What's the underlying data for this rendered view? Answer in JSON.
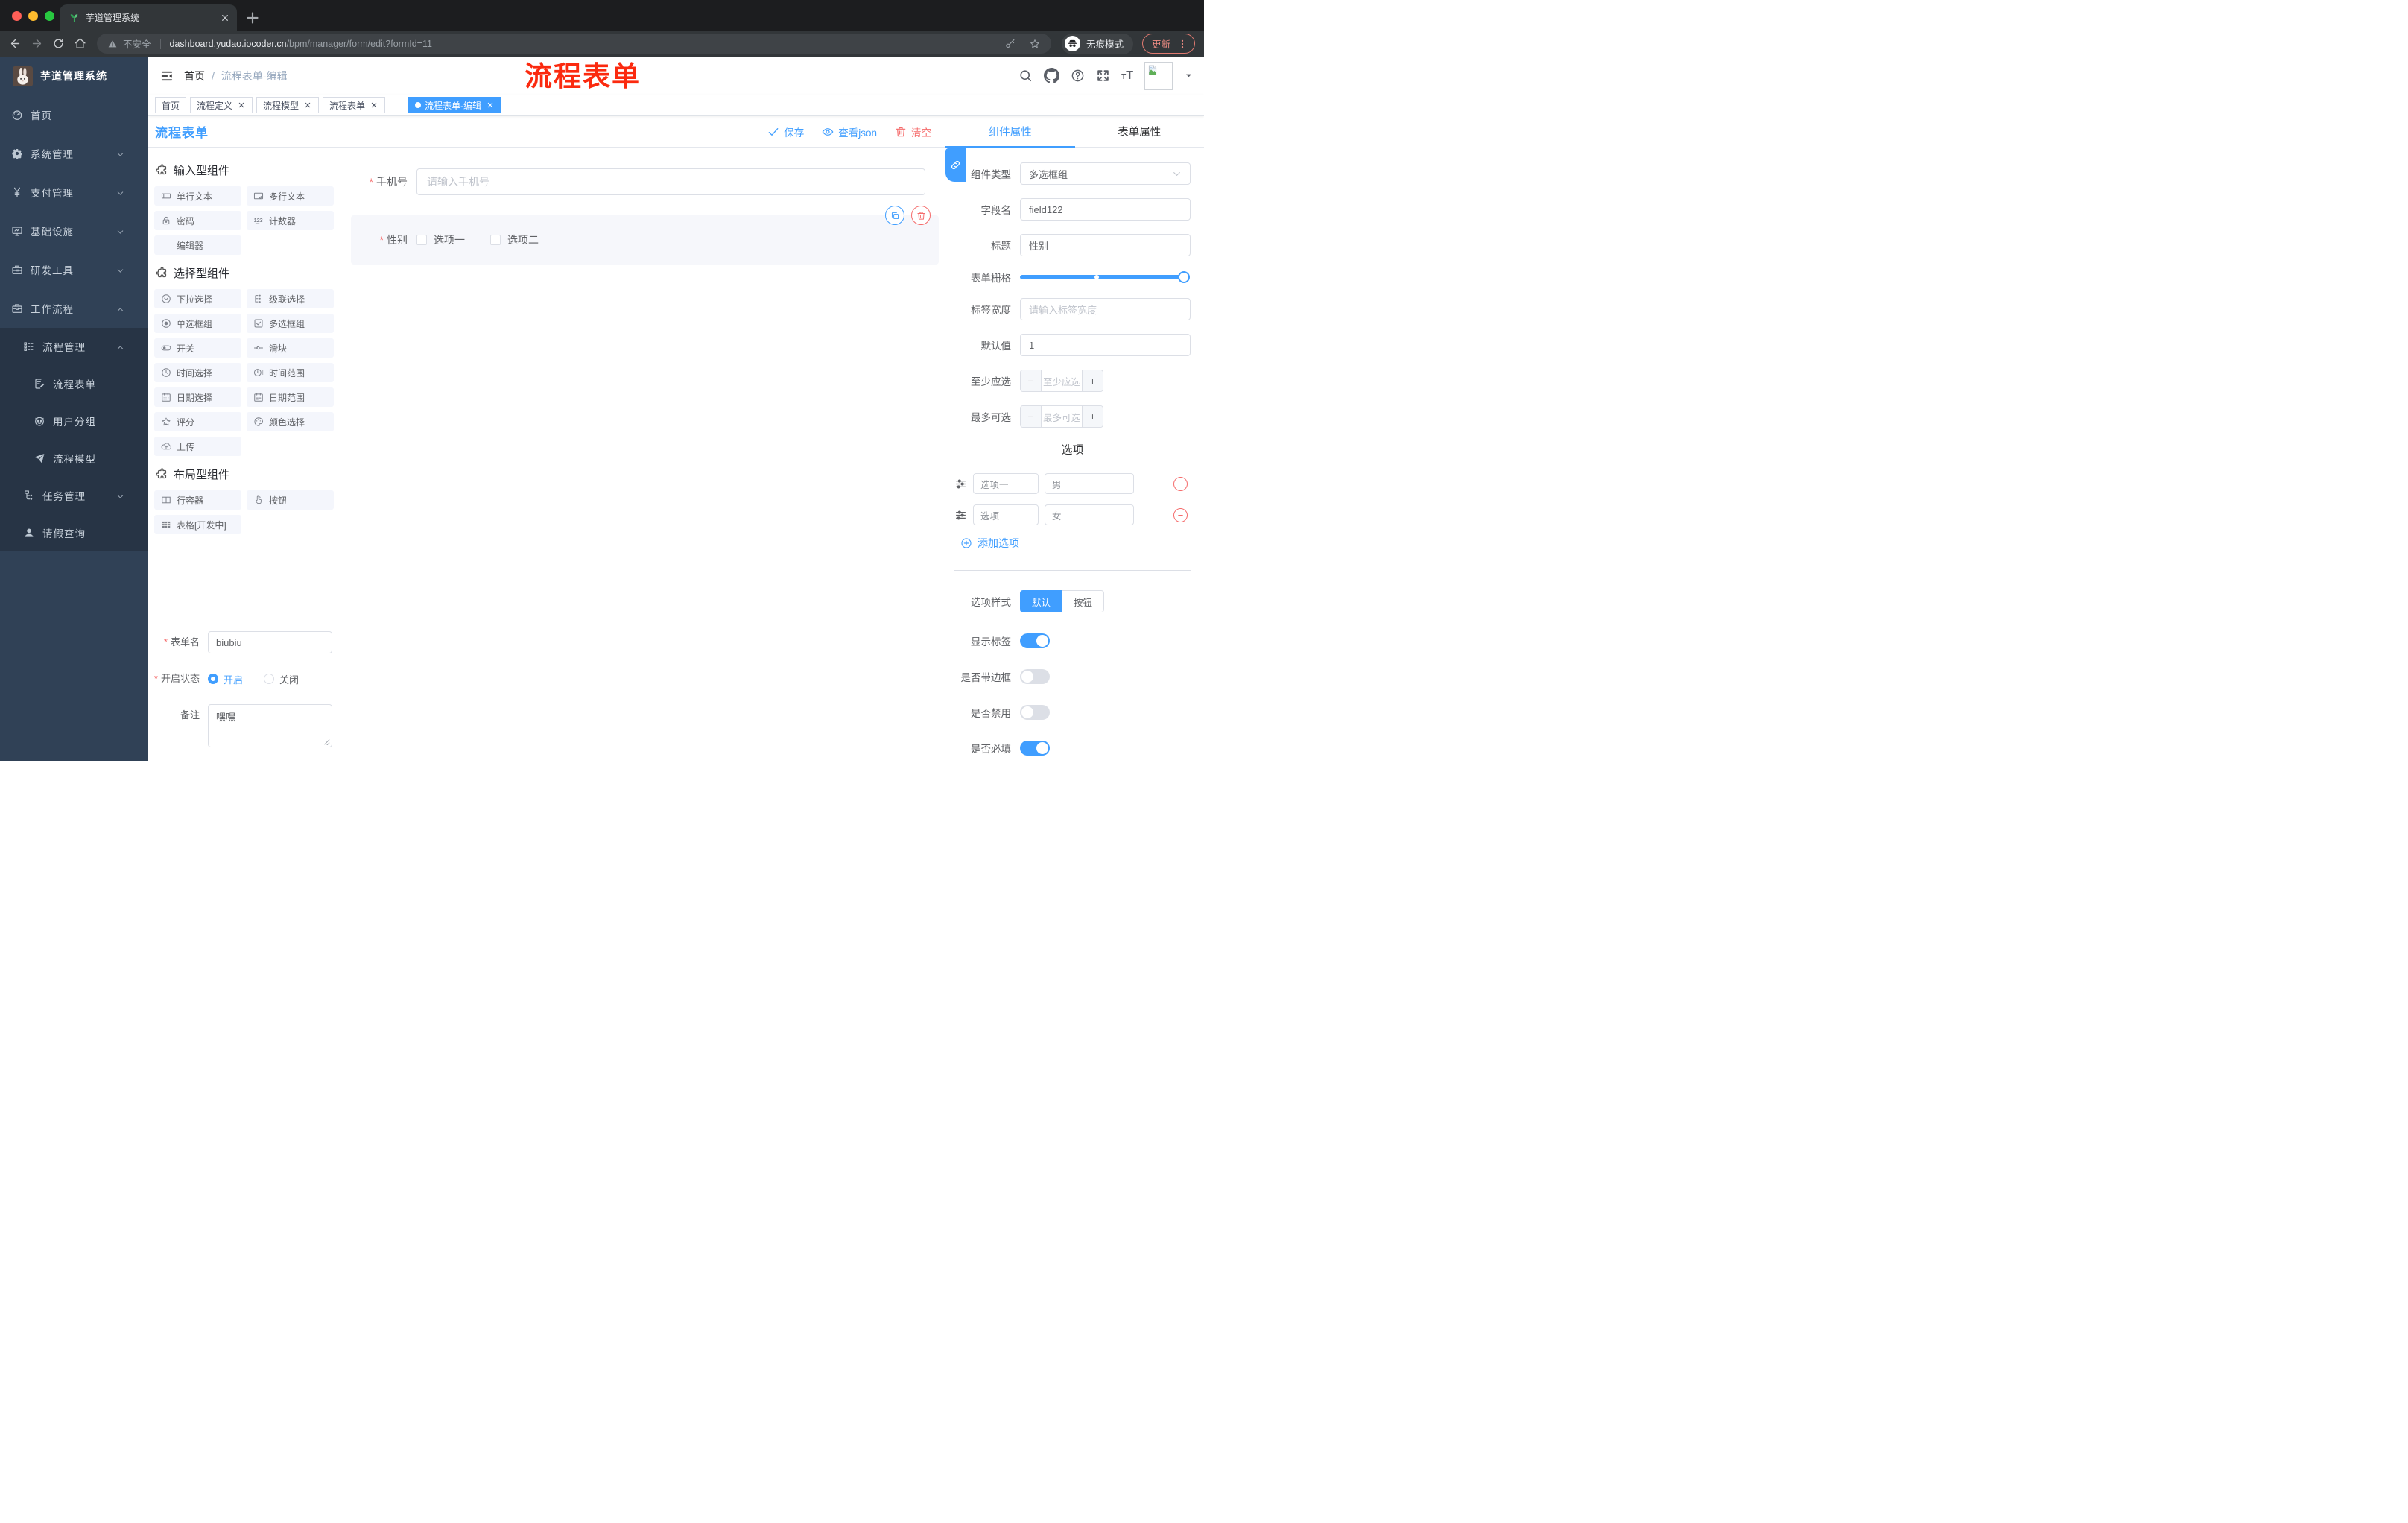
{
  "colors": {
    "primary": "#409EFF",
    "danger": "#F56C6C",
    "annotation_red": "#FB2A0F",
    "sidebar_bg": "#304156",
    "sidebar_submenu_bg": "#273445"
  },
  "browser": {
    "tab_title": "芋道管理系统",
    "security": "不安全",
    "url_domain": "dashboard.yudao.iocoder.cn",
    "url_path": "/bpm/manager/form/edit?formId=11",
    "incognito": "无痕模式",
    "update": "更新"
  },
  "sidebar": {
    "title": "芋道管理系统",
    "items": [
      {
        "key": "home",
        "label": "首页",
        "icon": "dashboard-icon",
        "level": 1,
        "chevron": null,
        "dark": false
      },
      {
        "key": "system",
        "label": "系统管理",
        "icon": "gear-icon",
        "level": 1,
        "chevron": "down",
        "dark": false
      },
      {
        "key": "payment",
        "label": "支付管理",
        "icon": "yen-icon",
        "level": 1,
        "chevron": "down",
        "dark": false
      },
      {
        "key": "infra",
        "label": "基础设施",
        "icon": "monitor-icon",
        "level": 1,
        "chevron": "down",
        "dark": false
      },
      {
        "key": "devtools",
        "label": "研发工具",
        "icon": "toolbox-icon",
        "level": 1,
        "chevron": "down",
        "dark": false
      },
      {
        "key": "workflow",
        "label": "工作流程",
        "icon": "briefcase-icon",
        "level": 1,
        "chevron": "up",
        "dark": false
      },
      {
        "key": "process-management",
        "label": "流程管理",
        "icon": "tree-list-icon",
        "level": 2,
        "chevron": "up",
        "dark": true
      },
      {
        "key": "process-form",
        "label": "流程表单",
        "icon": "form-edit-icon",
        "level": 3,
        "chevron": null,
        "dark": true
      },
      {
        "key": "user-group",
        "label": "用户分组",
        "icon": "robot-icon",
        "level": 3,
        "chevron": null,
        "dark": true
      },
      {
        "key": "process-model",
        "label": "流程模型",
        "icon": "paper-plane-icon",
        "level": 3,
        "chevron": null,
        "dark": true
      },
      {
        "key": "task-management",
        "label": "任务管理",
        "icon": "org-tree-icon",
        "level": 2,
        "chevron": "down",
        "dark": true
      },
      {
        "key": "leave-query",
        "label": "请假查询",
        "icon": "user-icon",
        "level": 2,
        "chevron": null,
        "dark": true
      }
    ]
  },
  "header": {
    "breadcrumb_home": "首页",
    "breadcrumb_sep": "/",
    "breadcrumb_current": "流程表单-编辑",
    "annotation": "流程表单"
  },
  "tags": [
    {
      "key": "home",
      "label": "首页",
      "closable": false,
      "active": false
    },
    {
      "key": "process-definition",
      "label": "流程定义",
      "closable": true,
      "active": false
    },
    {
      "key": "process-model",
      "label": "流程模型",
      "closable": true,
      "active": false
    },
    {
      "key": "process-form",
      "label": "流程表单",
      "closable": true,
      "active": false
    },
    {
      "key": "process-form-edit",
      "label": "流程表单-编辑",
      "closable": true,
      "active": true
    }
  ],
  "designer": {
    "panel_title": "流程表单",
    "toolbar": {
      "save": "保存",
      "view_json": "查看json",
      "clear": "清空"
    },
    "groups": [
      {
        "title": "输入型组件",
        "items": [
          {
            "key": "input",
            "label": "单行文本",
            "icon": "input-icon"
          },
          {
            "key": "textarea",
            "label": "多行文本",
            "icon": "textarea-icon"
          },
          {
            "key": "password",
            "label": "密码",
            "icon": "lock-icon"
          },
          {
            "key": "counter",
            "label": "计数器",
            "icon": "counter-icon"
          },
          {
            "key": "editor",
            "label": "编辑器",
            "icon": null
          }
        ]
      },
      {
        "title": "选择型组件",
        "items": [
          {
            "key": "select",
            "label": "下拉选择",
            "icon": "select-icon"
          },
          {
            "key": "cascader",
            "label": "级联选择",
            "icon": "cascader-icon"
          },
          {
            "key": "radio-group",
            "label": "单选框组",
            "icon": "radio-icon"
          },
          {
            "key": "checkbox-group",
            "label": "多选框组",
            "icon": "checkbox-icon"
          },
          {
            "key": "switch",
            "label": "开关",
            "icon": "switch-icon"
          },
          {
            "key": "slider",
            "label": "滑块",
            "icon": "slider-icon"
          },
          {
            "key": "time-picker",
            "label": "时间选择",
            "icon": "time-icon"
          },
          {
            "key": "time-range",
            "label": "时间范围",
            "icon": "time-range-icon"
          },
          {
            "key": "date-picker",
            "label": "日期选择",
            "icon": "date-icon"
          },
          {
            "key": "date-range",
            "label": "日期范围",
            "icon": "date-range-icon"
          },
          {
            "key": "rate",
            "label": "评分",
            "icon": "star-outline-icon"
          },
          {
            "key": "color-picker",
            "label": "颜色选择",
            "icon": "palette-icon"
          },
          {
            "key": "upload",
            "label": "上传",
            "icon": "upload-icon"
          }
        ]
      },
      {
        "title": "布局型组件",
        "items": [
          {
            "key": "row-container",
            "label": "行容器",
            "icon": "row-icon"
          },
          {
            "key": "button",
            "label": "按钮",
            "icon": "pointer-icon"
          },
          {
            "key": "table",
            "label": "表格[开发中]",
            "icon": "table-icon"
          }
        ]
      }
    ],
    "meta": {
      "name_label": "表单名",
      "name_value": "biubiu",
      "status_label": "开启状态",
      "status_on": "开启",
      "status_off": "关闭",
      "status_selected": "开启",
      "remark_label": "备注",
      "remark_value": "嘿嘿"
    },
    "canvas": {
      "phone": {
        "label": "手机号",
        "placeholder": "请输入手机号"
      },
      "gender": {
        "label": "性别",
        "options": [
          "选项一",
          "选项二"
        ]
      }
    }
  },
  "props": {
    "tab_component": "组件属性",
    "tab_form": "表单属性",
    "component_type_label": "组件类型",
    "component_type_value": "多选框组",
    "field_label": "字段名",
    "field_value": "field122",
    "title_label": "标题",
    "title_value": "性别",
    "grid_label": "表单栅格",
    "label_width_label": "标签宽度",
    "label_width_placeholder": "请输入标签宽度",
    "default_label": "默认值",
    "default_value": "1",
    "min_label": "至少应选",
    "min_placeholder": "至少应选",
    "max_label": "最多可选",
    "max_placeholder": "最多可选",
    "options_title": "选项",
    "options": [
      {
        "label": "选项一",
        "value": "男"
      },
      {
        "label": "选项二",
        "value": "女"
      }
    ],
    "add_option": "添加选项",
    "style_label": "选项样式",
    "style_default": "默认",
    "style_button": "按钮",
    "style_selected": "默认",
    "switches": [
      {
        "key": "show-label",
        "label": "显示标签",
        "on": true
      },
      {
        "key": "with-border",
        "label": "是否带边框",
        "on": false
      },
      {
        "key": "disabled",
        "label": "是否禁用",
        "on": false
      },
      {
        "key": "required",
        "label": "是否必填",
        "on": true
      }
    ]
  }
}
